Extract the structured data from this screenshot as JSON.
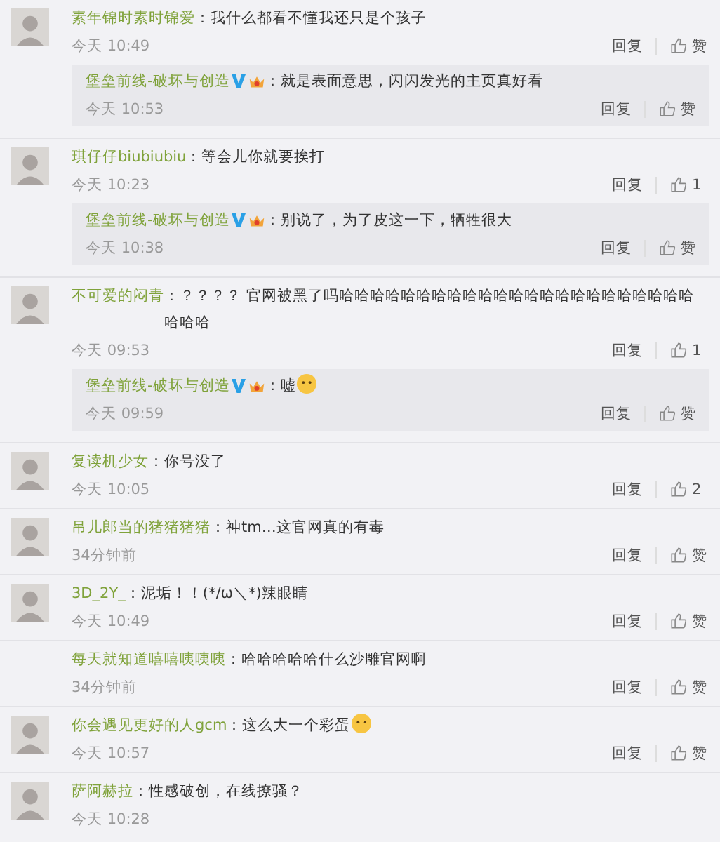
{
  "comments": [
    {
      "user": "素年锦时素时锦爱",
      "text": "：我什么都看不懂我还只是个孩子",
      "avatar": true,
      "time": "今天 10:49",
      "reply": "回复",
      "like": "赞",
      "replies": [
        {
          "user": "堡垒前线-破坏与创造",
          "verified": true,
          "text": "：就是表面意思，闪闪发光的主页真好看",
          "time": "今天 10:53",
          "reply": "回复",
          "like": "赞"
        }
      ]
    },
    {
      "user": "琪仔仔biubiubiu",
      "text": "：等会儿你就要挨打",
      "avatar": true,
      "time": "今天 10:23",
      "reply": "回复",
      "like": "1",
      "replies": [
        {
          "user": "堡垒前线-破坏与创造",
          "verified": true,
          "text": "：别说了，为了皮这一下，牺牲很大",
          "time": "今天 10:38",
          "reply": "回复",
          "like": "赞"
        }
      ]
    },
    {
      "user": "不可爱的闷青",
      "text": "：？？？？ 官网被黑了吗哈哈哈哈哈哈哈哈哈哈哈哈哈哈哈哈哈哈哈哈哈哈哈哈哈哈",
      "avatar": true,
      "time": "今天 09:53",
      "reply": "回复",
      "like": "1",
      "replies": [
        {
          "user": "堡垒前线-破坏与创造",
          "verified": true,
          "text": "：嘘",
          "emoji": true,
          "time": "今天 09:59",
          "reply": "回复",
          "like": "赞"
        }
      ]
    },
    {
      "user": "复读机少女",
      "text": "：你号没了",
      "avatar": true,
      "time": "今天 10:05",
      "reply": "回复",
      "like": "2"
    },
    {
      "user": "吊儿郎当的猪猪猪猪",
      "text": "：神tm…这官网真的有毒",
      "avatar": true,
      "time": "34分钟前",
      "reply": "回复",
      "like": "赞"
    },
    {
      "user": "3D_2Y_",
      "text": "：泥垢！！(*/ω＼*)辣眼睛",
      "avatar": true,
      "time": "今天 10:49",
      "reply": "回复",
      "like": "赞"
    },
    {
      "user": "每天就知道嘻嘻咦咦咦",
      "text": "：哈哈哈哈哈什么沙雕官网啊",
      "avatar": false,
      "time": "34分钟前",
      "reply": "回复",
      "like": "赞"
    },
    {
      "user": "你会遇见更好的人gcm",
      "text": "：这么大一个彩蛋",
      "emoji": true,
      "avatar": true,
      "time": "今天 10:57",
      "reply": "回复",
      "like": "赞"
    },
    {
      "user": "萨阿赫拉",
      "text": "：性感破创，在线撩骚？",
      "avatar": true,
      "time": "今天 10:28"
    }
  ]
}
